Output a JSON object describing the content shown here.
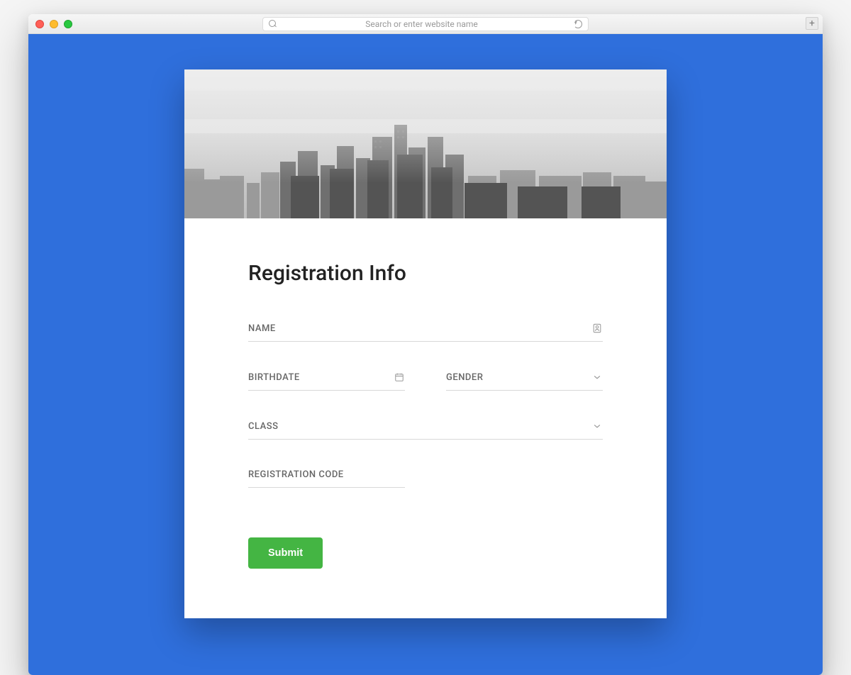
{
  "browser": {
    "address_placeholder": "Search or enter website name"
  },
  "form": {
    "title": "Registration Info",
    "fields": {
      "name": {
        "label": "NAME"
      },
      "birthdate": {
        "label": "BIRTHDATE"
      },
      "gender": {
        "label": "GENDER"
      },
      "class": {
        "label": "CLASS"
      },
      "code": {
        "label": "REGISTRATION CODE"
      }
    },
    "submit_label": "Submit"
  },
  "colors": {
    "page_bg": "#2f6fdc",
    "submit_bg": "#44b543"
  }
}
